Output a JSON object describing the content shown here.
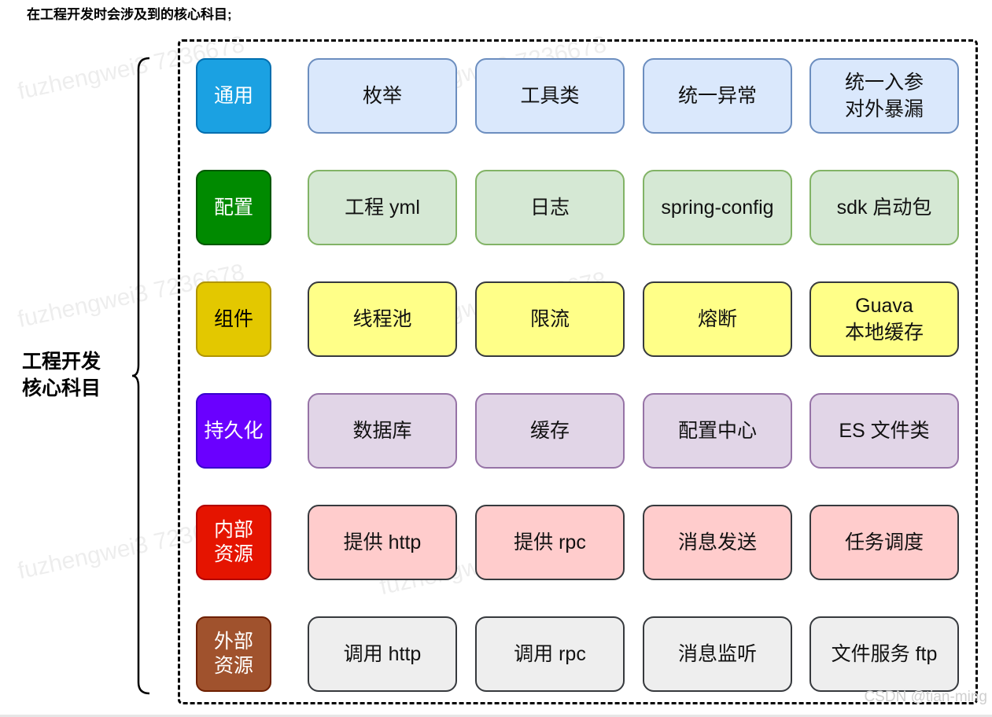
{
  "heading": "在工程开发时会涉及到的核心科目;",
  "side_label": "工程开发\n核心科目",
  "watermark_text": "fuzhengwei3 7236678",
  "credit": "CSDN @tian-ming",
  "rows": [
    {
      "category": "通用",
      "cat_color": "#1ba1e2",
      "cat_border": "#006eaf",
      "cell_fill": "#dae8fc",
      "cell_border": "#6c8ebf",
      "items": [
        "枚举",
        "工具类",
        "统一异常",
        "统一入参\n对外暴漏"
      ]
    },
    {
      "category": "配置",
      "cat_color": "#008a00",
      "cat_border": "#005700",
      "cell_fill": "#d5e8d4",
      "cell_border": "#82b366",
      "items": [
        "工程 yml",
        "日志",
        "spring-config",
        "sdk 启动包"
      ]
    },
    {
      "category": "组件",
      "cat_color": "#e3c800",
      "cat_border": "#b09500",
      "cat_text": "#000000",
      "cell_fill": "#ffff88",
      "cell_border": "#36393d",
      "items": [
        "线程池",
        "限流",
        "熔断",
        "Guava\n本地缓存"
      ]
    },
    {
      "category": "持久化",
      "cat_color": "#6a00ff",
      "cat_border": "#3700cc",
      "cell_fill": "#e1d5e7",
      "cell_border": "#9673a6",
      "items": [
        "数据库",
        "缓存",
        "配置中心",
        "ES 文件类"
      ]
    },
    {
      "category": "内部\n资源",
      "cat_color": "#e51400",
      "cat_border": "#b20000",
      "cell_fill": "#ffcccc",
      "cell_border": "#36393d",
      "items": [
        "提供 http",
        "提供 rpc",
        "消息发送",
        "任务调度"
      ]
    },
    {
      "category": "外部\n资源",
      "cat_color": "#a0522d",
      "cat_border": "#6d1f00",
      "cell_fill": "#eeeeee",
      "cell_border": "#36393d",
      "items": [
        "调用 http",
        "调用 rpc",
        "消息监听",
        "文件服务 ftp"
      ]
    }
  ]
}
